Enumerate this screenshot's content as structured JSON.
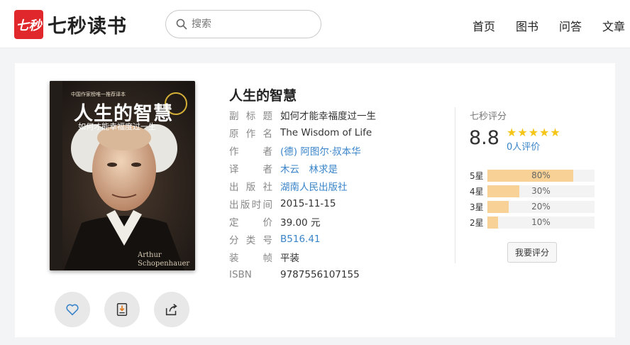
{
  "header": {
    "logo_mark": "七秒",
    "logo_text": "七秒读书",
    "search_placeholder": "搜索",
    "nav": [
      "首页",
      "图书",
      "问答",
      "文章"
    ]
  },
  "book": {
    "title": "人生的智慧",
    "cover": {
      "top_line": "中国作家榜唯一推荐译本",
      "title": "人生的智慧",
      "subtitle": "如何才能幸福度过一生",
      "author_latin_1": "Arthur",
      "author_latin_2": "Schopenhauer"
    },
    "fields": [
      {
        "label": "副标题",
        "value": "如何才能幸福度过一生",
        "link": false
      },
      {
        "label": "原作名",
        "value": "The Wisdom of Life",
        "link": false
      },
      {
        "label": "作者",
        "value": "(德) 阿图尔·叔本华",
        "link": true
      },
      {
        "label": "译者",
        "value": "木云　林求是",
        "link": true
      },
      {
        "label": "出版社",
        "value": "湖南人民出版社",
        "link": true
      },
      {
        "label": "出版时间",
        "value": "2015-11-15",
        "link": false
      },
      {
        "label": "定价",
        "value": "39.00 元",
        "link": false
      },
      {
        "label": "分类号",
        "value": "B516.41",
        "link": true
      },
      {
        "label": "装帧",
        "value": "平装",
        "link": false
      },
      {
        "label": "ISBN",
        "value": "9787556107155",
        "link": false
      }
    ]
  },
  "rating": {
    "label": "七秒评分",
    "score": "8.8",
    "stars": 5,
    "reviews": "0人评价",
    "distribution": [
      {
        "label": "5星",
        "percent": 80,
        "text": "80%"
      },
      {
        "label": "4星",
        "percent": 30,
        "text": "30%"
      },
      {
        "label": "3星",
        "percent": 20,
        "text": "20%"
      },
      {
        "label": "2星",
        "percent": 10,
        "text": "10%"
      }
    ],
    "rate_button": "我要评分"
  },
  "colors": {
    "brand": "#e0282c",
    "link": "#3a84c9",
    "star": "#f5c518",
    "bar": "#f7d195"
  }
}
